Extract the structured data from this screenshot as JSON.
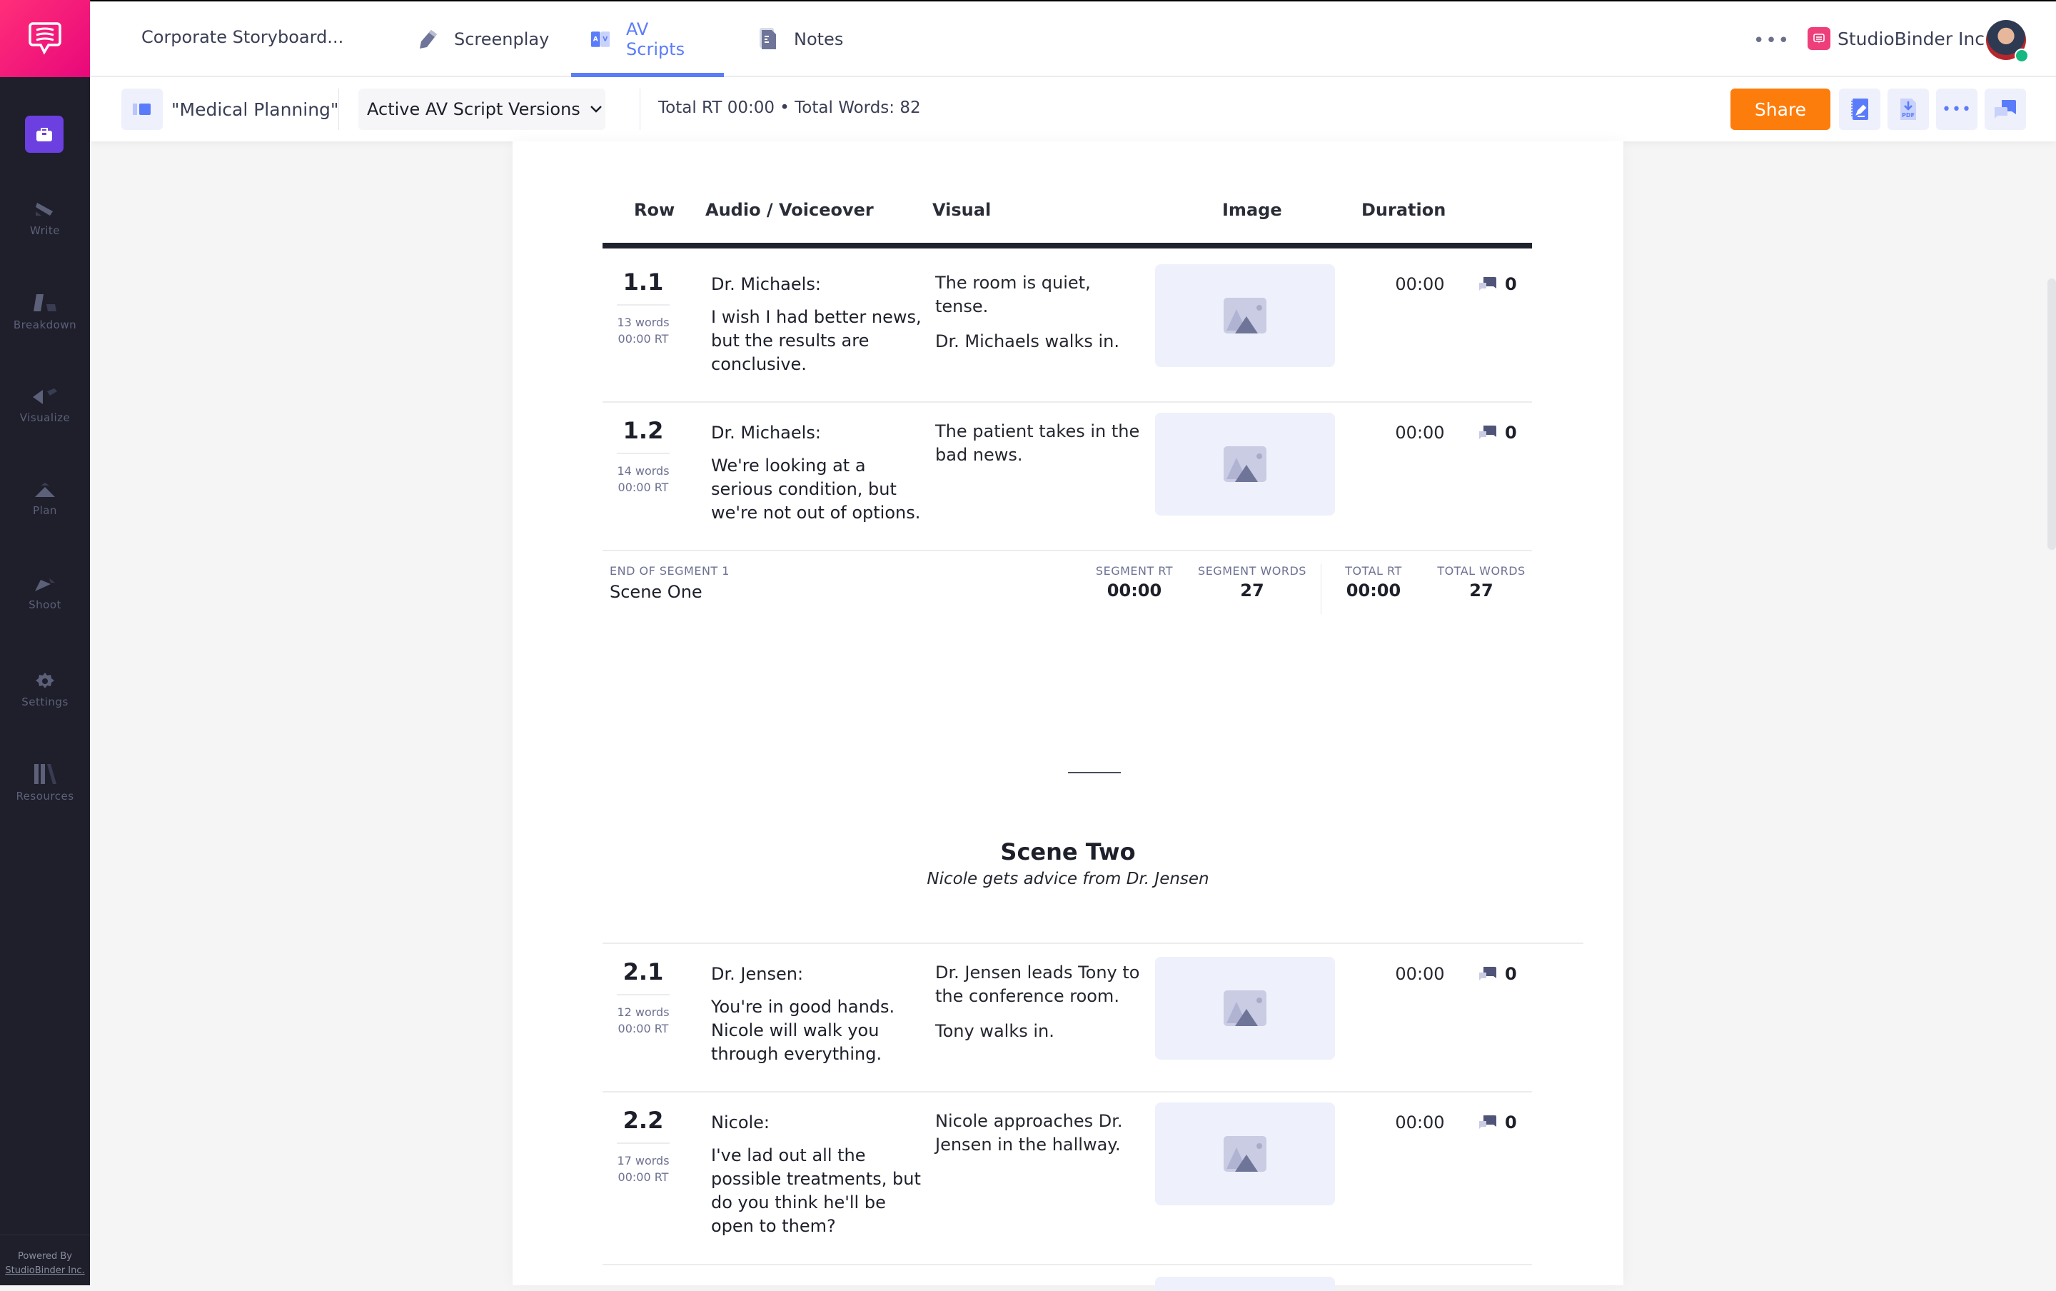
{
  "app": {
    "project_title": "Corporate Storyboard...",
    "tabs": [
      {
        "label": "Screenplay",
        "icon": "pencil-icon",
        "active": false
      },
      {
        "label": "AV Scripts",
        "icon": "av-icon",
        "active": true
      },
      {
        "label": "Notes",
        "icon": "document-icon",
        "active": false
      }
    ],
    "more_label": "•••",
    "company": "StudioBinder Inc.",
    "online_status": "online"
  },
  "sidebar": {
    "items": [
      {
        "label": "Write",
        "icon": "write-icon"
      },
      {
        "label": "Breakdown",
        "icon": "breakdown-icon"
      },
      {
        "label": "Visualize",
        "icon": "visualize-icon"
      },
      {
        "label": "Plan",
        "icon": "plan-icon"
      },
      {
        "label": "Shoot",
        "icon": "shoot-icon"
      },
      {
        "label": "Settings",
        "icon": "gear-icon"
      },
      {
        "label": "Resources",
        "icon": "resources-icon"
      }
    ],
    "powered_by_line1": "Powered By",
    "powered_by_line2": "StudioBinder Inc."
  },
  "toolbar": {
    "breadcrumb": "\"Medical Planning\"",
    "version_select": "Active AV Script Versions",
    "totals": "Total RT 00:00 • Total Words: 82",
    "share_label": "Share",
    "buttons": [
      "notebook-edit-icon",
      "pdf-download-icon",
      "more-icon",
      "comments-icon"
    ],
    "more_label": "•••",
    "pdf_label": "PDF"
  },
  "table": {
    "headers": [
      "Row",
      "Audio / Voiceover",
      "Visual",
      "Image",
      "Duration"
    ],
    "segments": [
      {
        "rows": [
          {
            "num": "1.1",
            "words": "13 words",
            "rt": "00:00 RT",
            "speaker": "Dr. Michaels:",
            "dialog": "I wish I had better news, but the results are conclusive.",
            "visual": [
              "The room is quiet, tense.",
              "Dr. Michaels walks in."
            ],
            "duration": "00:00",
            "comments": "0"
          },
          {
            "num": "1.2",
            "words": "14 words",
            "rt": "00:00 RT",
            "speaker": "Dr. Michaels:",
            "dialog": "We're looking at a serious condition, but we're not out of options.",
            "visual": [
              "The patient takes in the bad news."
            ],
            "duration": "00:00",
            "comments": "0"
          }
        ],
        "end": {
          "label": "END OF SEGMENT 1",
          "name": "Scene One",
          "segment_rt_label": "SEGMENT RT",
          "segment_rt": "00:00",
          "segment_words_label": "SEGMENT WORDS",
          "segment_words": "27",
          "total_rt_label": "TOTAL RT",
          "total_rt": "00:00",
          "total_words_label": "TOTAL WORDS",
          "total_words": "27"
        }
      },
      {
        "title": "Scene Two",
        "subtitle": "Nicole gets advice from Dr. Jensen",
        "rows": [
          {
            "num": "2.1",
            "words": "12 words",
            "rt": "00:00 RT",
            "speaker": "Dr. Jensen:",
            "dialog": "You're in good hands. Nicole will walk you through everything.",
            "visual": [
              "Dr. Jensen leads Tony to the conference room.",
              "Tony walks in."
            ],
            "duration": "00:00",
            "comments": "0"
          },
          {
            "num": "2.2",
            "words": "17 words",
            "rt": "00:00 RT",
            "speaker": "Nicole:",
            "dialog": "I've lad out all the possible treatments, but do you think he'll be open to them?",
            "visual": [
              "Nicole approaches Dr. Jensen in the hallway."
            ],
            "duration": "00:00",
            "comments": "0"
          }
        ]
      }
    ]
  },
  "colors": {
    "brand_pink": "#ee3f7a",
    "accent_blue": "#5b7cfa",
    "share_orange": "#fd7d0c",
    "sidebar_bg": "#1e1f2b",
    "active_module": "#6c3fe0"
  }
}
